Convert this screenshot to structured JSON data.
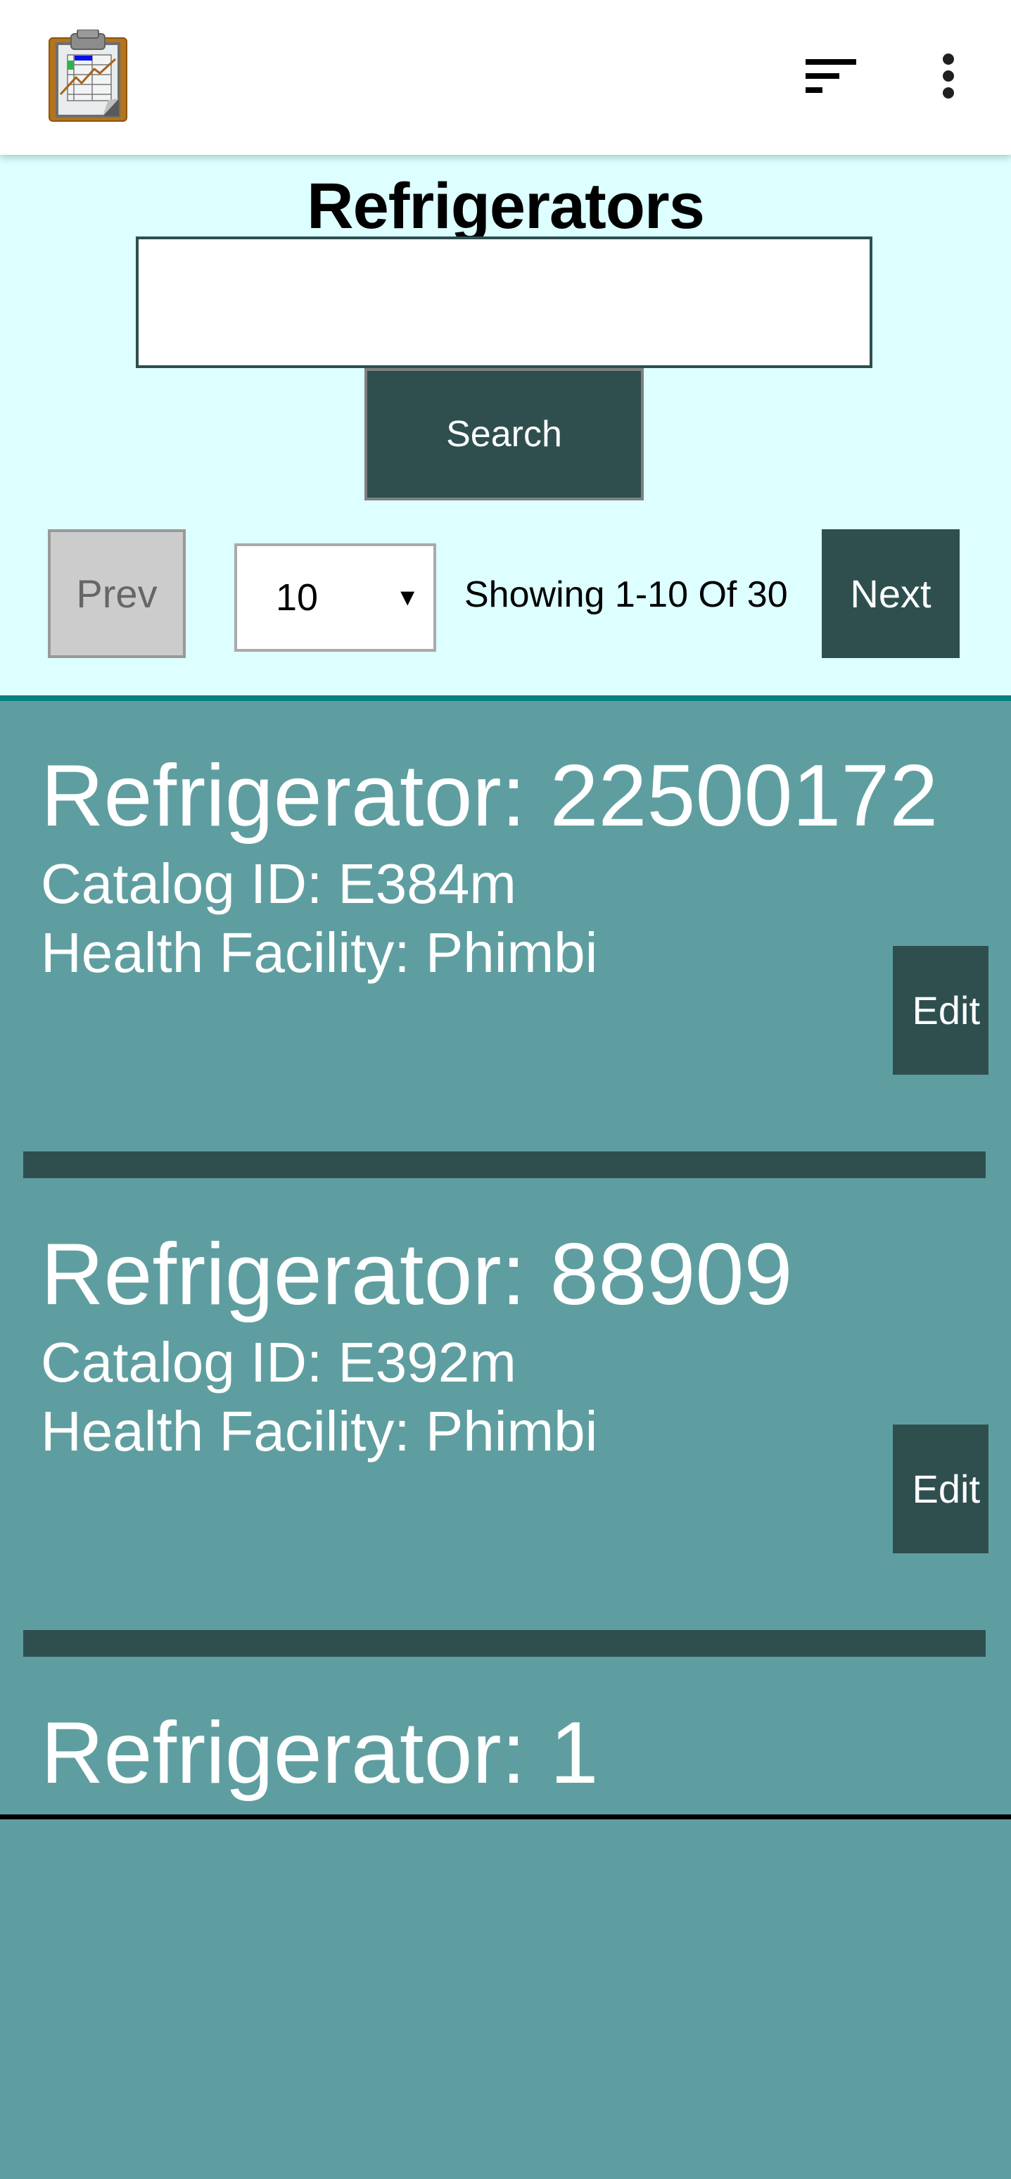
{
  "app": {
    "logo_icon": "clipboard-chart-icon",
    "sort_icon": "sort-icon",
    "menu_icon": "more-vert-icon"
  },
  "page": {
    "title": "Refrigerators"
  },
  "search": {
    "value": "",
    "placeholder": "",
    "button_label": "Search"
  },
  "pagination": {
    "prev_label": "Prev",
    "next_label": "Next",
    "page_size": "10",
    "page_size_arrow": "▼",
    "showing_text": "Showing 1-10 Of 30",
    "prev_enabled": false
  },
  "colors": {
    "header_bg": "#FFFFFF",
    "top_panel_bg": "#DDFFFF",
    "accent_rule": "#008080",
    "list_bg": "#5F9EA0",
    "dark_button": "#2F4F4F",
    "disabled_button": "#CCCCCC"
  },
  "refrigerators": [
    {
      "title": "Refrigerator: 22500172",
      "catalog": "Catalog ID: E384m",
      "facility": "Health Facility: Phimbi",
      "edit_label": "Edit"
    },
    {
      "title": "Refrigerator: 88909",
      "catalog": "Catalog ID: E392m",
      "facility": "Health Facility: Phimbi",
      "edit_label": "Edit"
    },
    {
      "title": "Refrigerator: 1"
    }
  ]
}
